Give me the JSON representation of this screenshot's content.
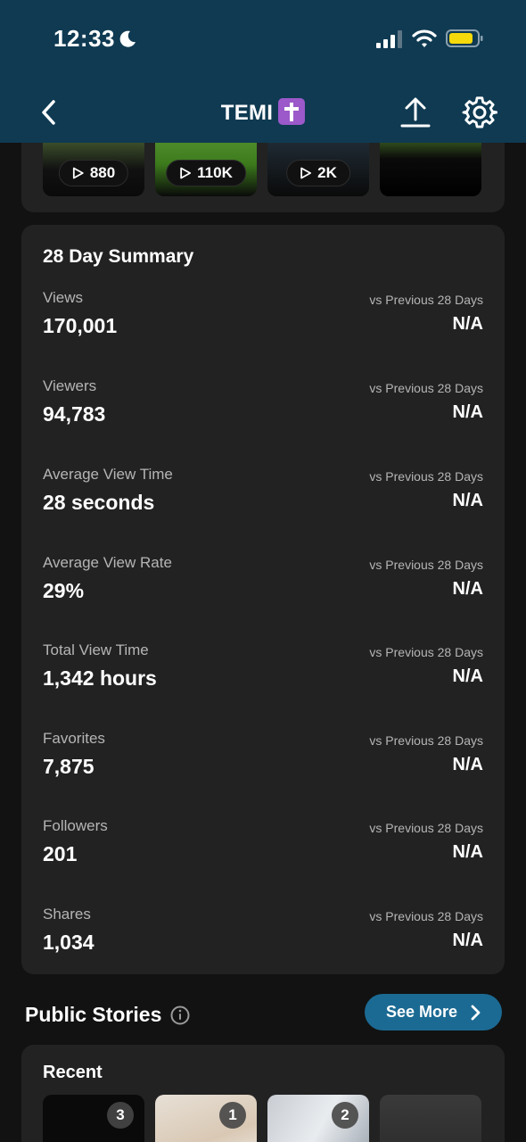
{
  "status_bar": {
    "time": "12:33",
    "icons": [
      "moon-icon",
      "signal-icon",
      "wifi-icon",
      "battery-icon"
    ],
    "battery_color": "#f5d90a"
  },
  "nav": {
    "title": "TEMI",
    "title_badge": "latin-cross-emoji",
    "back_icon": "chevron-left-icon",
    "share_icon": "upload-icon",
    "settings_icon": "gear-icon"
  },
  "thumbnails": [
    {
      "views": "880"
    },
    {
      "views": "110K"
    },
    {
      "views": "2K"
    },
    {
      "views": ""
    }
  ],
  "summary": {
    "title": "28 Day Summary",
    "compare_label": "vs Previous 28 Days",
    "metrics": [
      {
        "label": "Views",
        "value": "170,001",
        "change": "N/A"
      },
      {
        "label": "Viewers",
        "value": "94,783",
        "change": "N/A"
      },
      {
        "label": "Average View Time",
        "value": "28 seconds",
        "change": "N/A"
      },
      {
        "label": "Average View Rate",
        "value": "29%",
        "change": "N/A"
      },
      {
        "label": "Total View Time",
        "value": "1,342 hours",
        "change": "N/A"
      },
      {
        "label": "Favorites",
        "value": "7,875",
        "change": "N/A"
      },
      {
        "label": "Followers",
        "value": "201",
        "change": "N/A"
      },
      {
        "label": "Shares",
        "value": "1,034",
        "change": "N/A"
      }
    ]
  },
  "public_stories": {
    "title": "Public Stories",
    "see_more_label": "See More",
    "recent_title": "Recent",
    "stories": [
      {
        "count": "3"
      },
      {
        "count": "1"
      },
      {
        "count": "2"
      },
      {
        "count": ""
      }
    ]
  },
  "colors": {
    "header_bg": "#0f3a52",
    "card_bg": "#222222",
    "page_bg": "#121212",
    "accent_button": "#1b6a93"
  }
}
